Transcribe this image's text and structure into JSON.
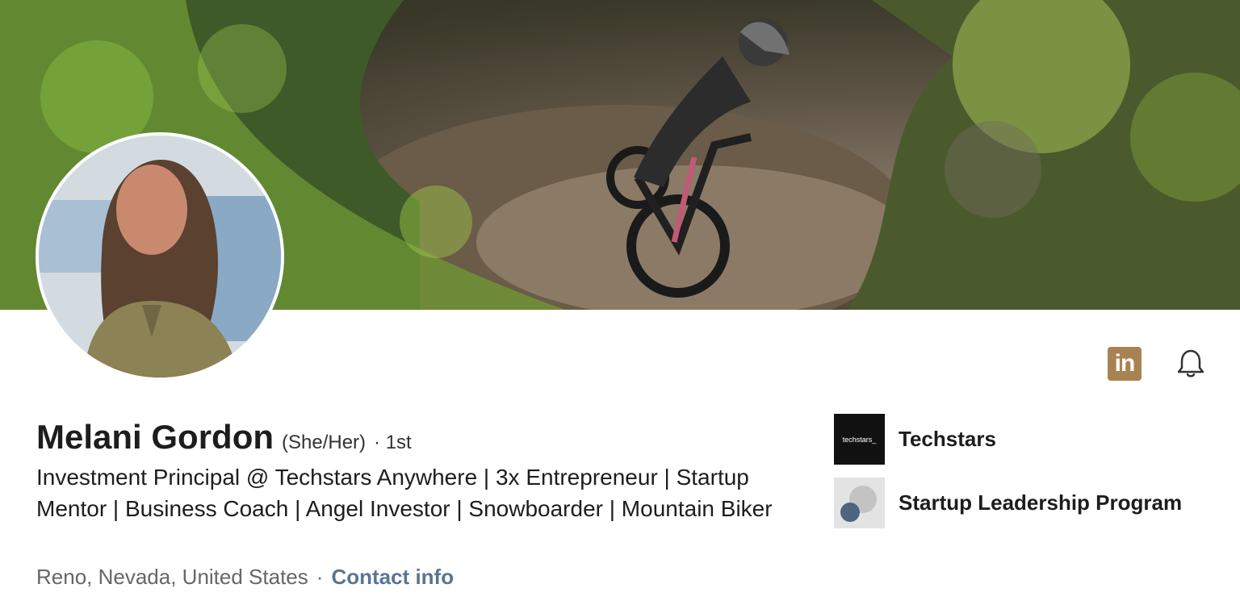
{
  "profile": {
    "name": "Melani Gordon",
    "pronouns": "(She/Her)",
    "degree": "· 1st",
    "headline": "Investment Principal @ Techstars Anywhere | 3x Entrepreneur | Startup Mentor | Business Coach | Angel Investor | Snowboarder | Mountain Biker",
    "location": "Reno, Nevada, United States",
    "separator": "·",
    "contact_label": "Contact info"
  },
  "actions": {
    "linkedin_icon": "linkedin-icon",
    "linkedin_text": "in",
    "bell_icon": "bell-icon"
  },
  "organizations": [
    {
      "name": "Techstars",
      "logo_text": "techstars_",
      "logo_icon": "techstars-logo"
    },
    {
      "name": "Startup Leadership Program",
      "logo_icon": "slp-logo"
    }
  ],
  "colors": {
    "link": "#5a7593",
    "linkedin_brand": "#a88352",
    "text": "#1d1d1d"
  }
}
